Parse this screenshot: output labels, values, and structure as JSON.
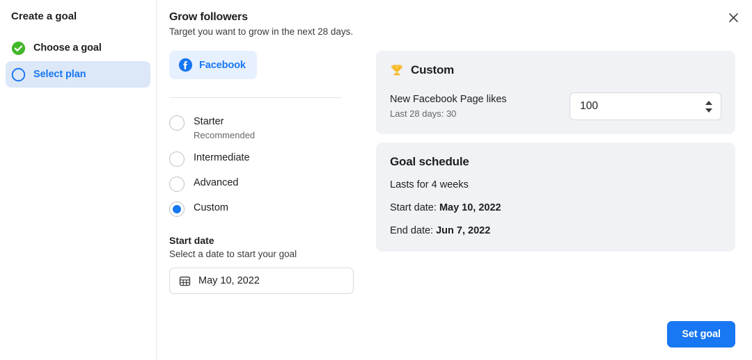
{
  "sidebar": {
    "title": "Create a goal",
    "steps": [
      {
        "label": "Choose a goal",
        "state": "completed",
        "icon": "check-circle-icon"
      },
      {
        "label": "Select plan",
        "state": "current",
        "icon": "circle-outline-icon"
      }
    ]
  },
  "header": {
    "title": "Grow followers",
    "subtitle": "Target you want to grow in the next 28 days.",
    "close_icon": "close-icon"
  },
  "channel_tab": {
    "label": "Facebook",
    "icon": "facebook-icon",
    "selected": true
  },
  "plans": {
    "options": [
      {
        "label": "Starter",
        "sub": "Recommended",
        "checked": false
      },
      {
        "label": "Intermediate",
        "sub": "",
        "checked": false
      },
      {
        "label": "Advanced",
        "sub": "",
        "checked": false
      },
      {
        "label": "Custom",
        "sub": "",
        "checked": true
      }
    ]
  },
  "start_date": {
    "title": "Start date",
    "description": "Select a date to start your goal",
    "value": "May 10, 2022",
    "icon": "calendar-icon"
  },
  "custom_card": {
    "icon": "trophy-icon",
    "title": "Custom",
    "metric_name": "New Facebook Page likes",
    "metric_sub": "Last 28 days: 30",
    "value": "100",
    "stepper_up_icon": "arrow-up-icon",
    "stepper_down_icon": "arrow-down-icon"
  },
  "schedule_card": {
    "title": "Goal schedule",
    "duration": "Lasts for 4 weeks",
    "start_label": "Start date:",
    "start_value": "May 10, 2022",
    "end_label": "End date:",
    "end_value": "Jun 7, 2022"
  },
  "footer": {
    "primary_label": "Set goal"
  },
  "colors": {
    "accent": "#1877f2",
    "success": "#42b72a",
    "card_bg": "#f0f2f5",
    "active_step_bg": "#dce7f8",
    "trophy": "#f7b928"
  }
}
